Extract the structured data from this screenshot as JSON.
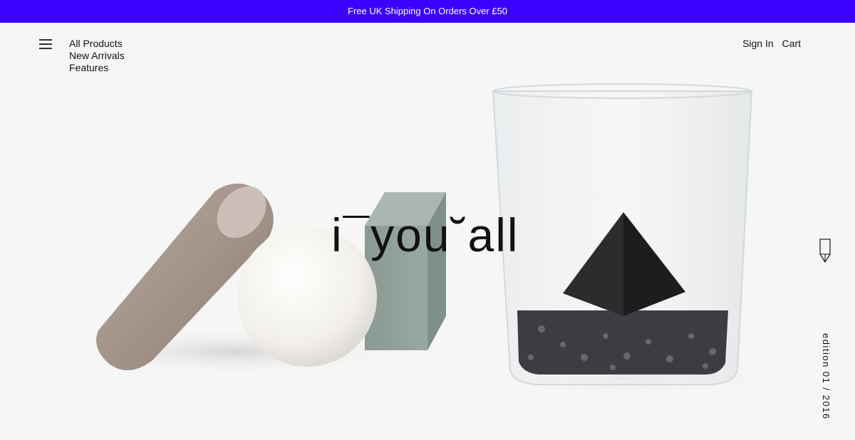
{
  "promo": {
    "text": "Free UK Shipping On Orders Over £50",
    "background": "#3b00ff"
  },
  "nav": {
    "items": [
      "All Products",
      "New Arrivals",
      "Features"
    ]
  },
  "account": {
    "sign_in": "Sign In",
    "cart": "Cart"
  },
  "hero": {
    "logo_text": "i¯you˘all",
    "edition": "edition 01 / 2016",
    "icons": [
      "menu-icon",
      "pencil-icon"
    ]
  }
}
